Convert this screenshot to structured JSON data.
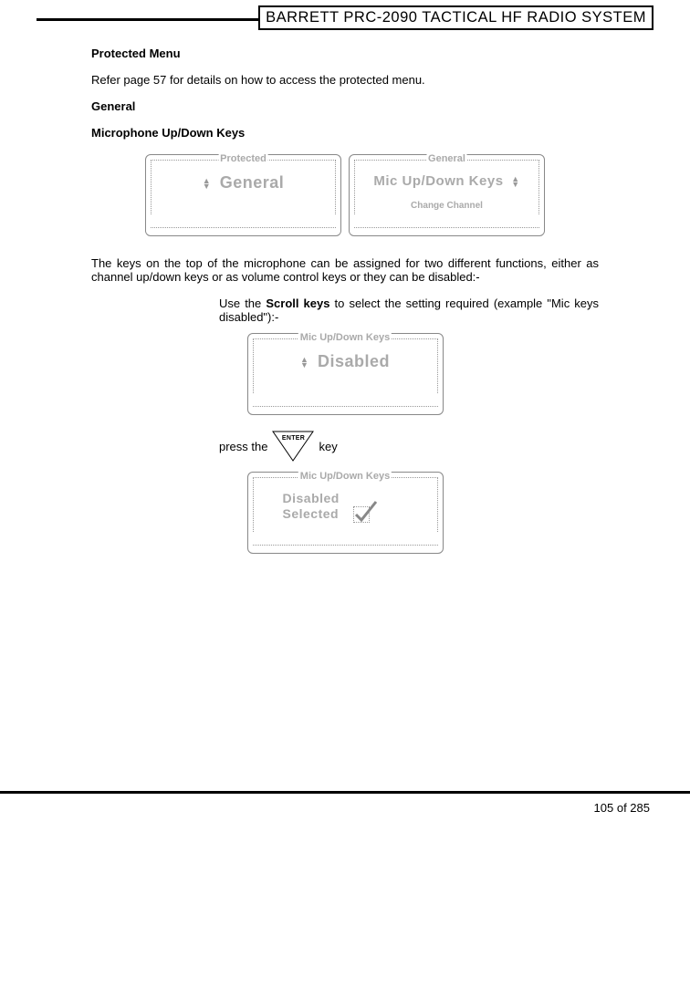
{
  "header": {
    "title": "BARRETT PRC-2090 TACTICAL HF RADIO SYSTEM"
  },
  "section": {
    "h1": "Protected Menu",
    "p1": " Refer page 57 for details on how to access the protected menu.",
    "h2": "General",
    "h3": "Microphone Up/Down Keys",
    "p2": "The keys on the top of the microphone can be assigned for two different functions, either as channel up/down keys or as volume control keys or they can be disabled:-",
    "p3_pre": "Use the ",
    "p3_bold": "Scroll keys",
    "p3_post": " to select the setting required (example \"Mic keys disabled\"):-",
    "press_pre": "press the ",
    "press_post": " key"
  },
  "enterKey": {
    "label": "ENTER"
  },
  "screens": {
    "s1": {
      "legend": "Protected",
      "main": "General"
    },
    "s2": {
      "legend": "General",
      "main": "Mic Up/Down Keys",
      "sub": "Change Channel"
    },
    "s3": {
      "legend": "Mic Up/Down Keys",
      "main": "Disabled"
    },
    "s4": {
      "legend": "Mic Up/Down Keys",
      "line1": "Disabled",
      "line2": "Selected"
    }
  },
  "footer": {
    "page": "105 of 285"
  }
}
